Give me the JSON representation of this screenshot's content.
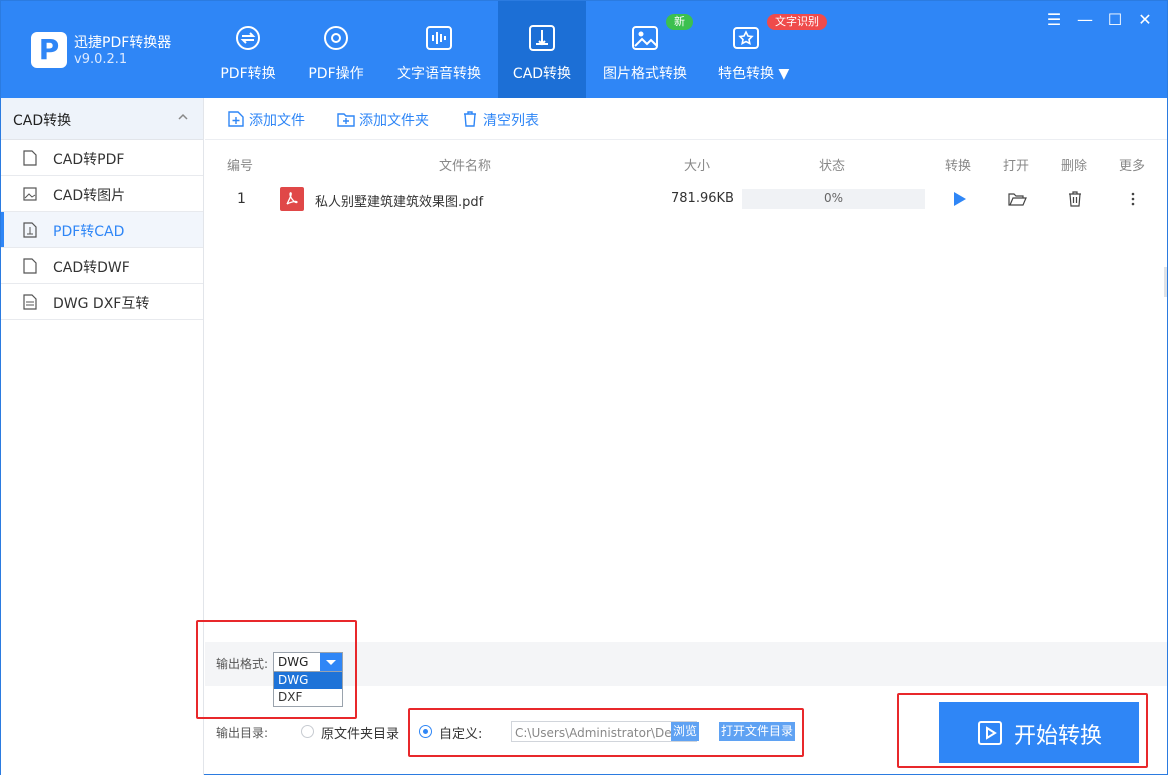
{
  "app": {
    "name": "迅捷PDF转换器",
    "version": "v9.0.2.1"
  },
  "nav": [
    {
      "label": "PDF转换",
      "icon": "pdf-convert-icon"
    },
    {
      "label": "PDF操作",
      "icon": "pdf-operate-icon"
    },
    {
      "label": "文字语音转换",
      "icon": "voice-wave-icon"
    },
    {
      "label": "CAD转换",
      "icon": "cad-icon",
      "active": true
    },
    {
      "label": "图片格式转换",
      "icon": "image-icon"
    },
    {
      "label": "特色转换",
      "icon": "star-convert-icon"
    }
  ],
  "badges": {
    "new": "新",
    "ocr": "文字识别"
  },
  "window_controls": {
    "menu": "☰",
    "minimize": "—",
    "maximize": "☐",
    "close": "✕"
  },
  "sidebar": {
    "header": "CAD转换",
    "items": [
      {
        "label": "CAD转PDF"
      },
      {
        "label": "CAD转图片"
      },
      {
        "label": "PDF转CAD",
        "active": true
      },
      {
        "label": "CAD转DWF"
      },
      {
        "label": "DWG DXF互转"
      }
    ]
  },
  "toolbar": {
    "add_file": "添加文件",
    "add_folder": "添加文件夹",
    "clear_list": "清空列表"
  },
  "table": {
    "headers": {
      "index": "编号",
      "name": "文件名称",
      "size": "大小",
      "status": "状态",
      "convert": "转换",
      "open": "打开",
      "delete": "删除",
      "more": "更多"
    },
    "rows": [
      {
        "index": "1",
        "name": "私人别墅建筑建筑效果图.pdf",
        "size": "781.96KB",
        "status": "0%",
        "progress": 0
      }
    ]
  },
  "output": {
    "format_label": "输出格式:",
    "format_value": "DWG",
    "format_options": [
      "DWG",
      "DXF"
    ],
    "dir_label": "输出目录:",
    "original_dir": "原文件夹目录",
    "custom_label": "自定义:",
    "path": "C:\\Users\\Administrator\\Desktop",
    "browse": "浏览",
    "open_dir": "打开文件目录"
  },
  "start_button": "开始转换",
  "colors": {
    "accent": "#2f86f6",
    "highlight_box": "#e8282b"
  }
}
